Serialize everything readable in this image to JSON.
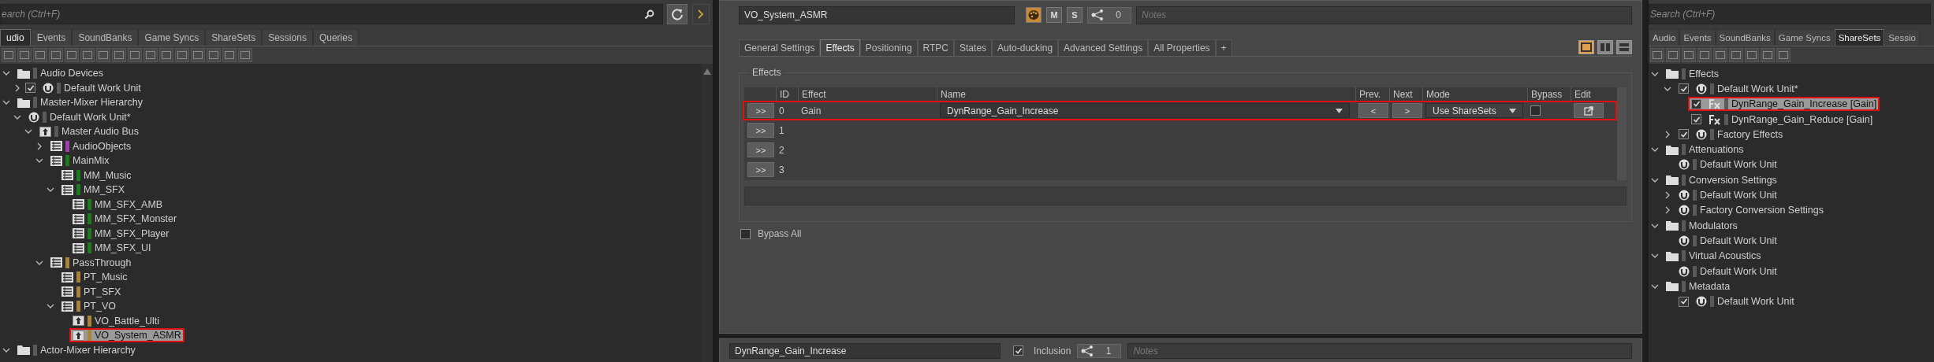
{
  "left_panel": {
    "search": {
      "placeholder": "earch (Ctrl+F)"
    },
    "tabs": [
      {
        "label": "udio",
        "selected": true
      },
      {
        "label": "Events",
        "selected": false
      },
      {
        "label": "SoundBanks",
        "selected": false
      },
      {
        "label": "Game Syncs",
        "selected": false
      },
      {
        "label": "ShareSets",
        "selected": false
      },
      {
        "label": "Sessions",
        "selected": false
      },
      {
        "label": "Queries",
        "selected": false
      }
    ],
    "tree": [
      {
        "label": "Audio Devices",
        "kind": "folder",
        "color": "#5a5a5a",
        "expanded": true,
        "selected": false,
        "highlighted": false,
        "children": [
          {
            "label": "Default Work Unit",
            "kind": "workunit",
            "color": "#5a5a5a",
            "expanded": false,
            "checked": true,
            "selected": false,
            "highlighted": false
          }
        ]
      },
      {
        "label": "Master-Mixer Hierarchy",
        "kind": "folder",
        "color": "#5a5a5a",
        "expanded": true,
        "selected": false,
        "highlighted": false,
        "children": [
          {
            "label": "Default Work Unit*",
            "kind": "workunit",
            "color": "#5a5a5a",
            "expanded": true,
            "selected": false,
            "highlighted": false,
            "children": [
              {
                "label": "Master Audio Bus",
                "kind": "bus",
                "color": "#5a5a5a",
                "expanded": true,
                "selected": false,
                "highlighted": false,
                "children": [
                  {
                    "label": "AudioObjects",
                    "kind": "mixbus",
                    "color": "#a040a8",
                    "expanded": false,
                    "selected": false,
                    "highlighted": false
                  },
                  {
                    "label": "MainMix",
                    "kind": "mixbus",
                    "color": "#1e7a1e",
                    "expanded": true,
                    "selected": false,
                    "highlighted": false,
                    "children": [
                      {
                        "label": "MM_Music",
                        "kind": "mixbus",
                        "color": "#1e7a1e",
                        "selected": false,
                        "highlighted": false
                      },
                      {
                        "label": "MM_SFX",
                        "kind": "mixbus",
                        "color": "#1e7a1e",
                        "expanded": true,
                        "selected": false,
                        "highlighted": false,
                        "children": [
                          {
                            "label": "MM_SFX_AMB",
                            "kind": "mixbus",
                            "color": "#1e7a1e",
                            "selected": false,
                            "highlighted": false
                          },
                          {
                            "label": "MM_SFX_Monster",
                            "kind": "mixbus",
                            "color": "#1e7a1e",
                            "selected": false,
                            "highlighted": false
                          },
                          {
                            "label": "MM_SFX_Player",
                            "kind": "mixbus",
                            "color": "#1e7a1e",
                            "selected": false,
                            "highlighted": false
                          },
                          {
                            "label": "MM_SFX_UI",
                            "kind": "mixbus",
                            "color": "#1e7a1e",
                            "selected": false,
                            "highlighted": false
                          }
                        ]
                      }
                    ]
                  },
                  {
                    "label": "PassThrough",
                    "kind": "mixbus",
                    "color": "#a8843c",
                    "expanded": true,
                    "selected": false,
                    "highlighted": false,
                    "children": [
                      {
                        "label": "PT_Music",
                        "kind": "mixbus",
                        "color": "#a8843c",
                        "selected": false,
                        "highlighted": false
                      },
                      {
                        "label": "PT_SFX",
                        "kind": "mixbus",
                        "color": "#a8843c",
                        "selected": false,
                        "highlighted": false
                      },
                      {
                        "label": "PT_VO",
                        "kind": "mixbus",
                        "color": "#a8843c",
                        "expanded": true,
                        "selected": false,
                        "highlighted": false,
                        "children": [
                          {
                            "label": "VO_Battle_Ulti",
                            "kind": "bus",
                            "color": "#a8843c",
                            "selected": false,
                            "highlighted": false
                          },
                          {
                            "label": "VO_System_ASMR",
                            "kind": "bus",
                            "color": "#a8843c",
                            "selected": true,
                            "highlighted": true
                          }
                        ]
                      }
                    ]
                  }
                ]
              }
            ]
          }
        ]
      },
      {
        "label": "Actor-Mixer Hierarchy",
        "kind": "folder",
        "color": "#5a5a5a",
        "expanded": true,
        "selected": false,
        "highlighted": false
      }
    ]
  },
  "editor": {
    "name": "VO_System_ASMR",
    "mute": "M",
    "solo": "S",
    "share_count": "0",
    "notes": {
      "placeholder": "Notes"
    },
    "tabs": [
      {
        "label": "General Settings",
        "selected": false
      },
      {
        "label": "Effects",
        "selected": true
      },
      {
        "label": "Positioning",
        "selected": false
      },
      {
        "label": "RTPC",
        "selected": false
      },
      {
        "label": "States",
        "selected": false
      },
      {
        "label": "Auto-ducking",
        "selected": false
      },
      {
        "label": "Advanced Settings",
        "selected": false
      },
      {
        "label": "All Properties",
        "selected": false
      }
    ],
    "add_tab": "+",
    "layouts": [
      {
        "selected": true
      },
      {
        "selected": false
      },
      {
        "selected": false
      }
    ],
    "group_title": "Effects",
    "columns": [
      "ID",
      "Effect",
      "Name",
      "Prev.",
      "Next",
      "Mode",
      "Bypass",
      "Edit"
    ],
    "rows": [
      {
        "button": ">>",
        "id": "0",
        "effect": "Gain",
        "name": "DynRange_Gain_Increase",
        "prev": "<",
        "next": ">",
        "mode": "Use ShareSets",
        "bypass": false,
        "highlighted": true
      },
      {
        "button": ">>",
        "id": "1",
        "highlighted": false
      },
      {
        "button": ">>",
        "id": "2",
        "highlighted": false
      },
      {
        "button": ">>",
        "id": "3",
        "highlighted": false
      }
    ],
    "bypass_all": {
      "label": "Bypass All",
      "checked": false
    }
  },
  "lower_editor": {
    "name": "DynRange_Gain_Increase",
    "inclusion": {
      "label": "Inclusion",
      "checked": true
    },
    "share_count": "1",
    "notes": {
      "placeholder": "Notes"
    }
  },
  "right_panel": {
    "search": {
      "placeholder": "Search (Ctrl+F)"
    },
    "tabs": [
      {
        "label": "Audio",
        "selected": false
      },
      {
        "label": "Events",
        "selected": false
      },
      {
        "label": "SoundBanks",
        "selected": false
      },
      {
        "label": "Game Syncs",
        "selected": false
      },
      {
        "label": "ShareSets",
        "selected": true
      },
      {
        "label": "Sessio",
        "selected": false
      }
    ],
    "tree": [
      {
        "label": "Effects",
        "kind": "folder",
        "color": "#5a5a5a",
        "expanded": true,
        "selected": false,
        "highlighted": false,
        "children": [
          {
            "label": "Default Work Unit*",
            "kind": "workunit",
            "color": "#5a5a5a",
            "expanded": true,
            "checked": true,
            "selected": false,
            "highlighted": false,
            "children": [
              {
                "label": "DynRange_Gain_Increase [Gain]",
                "kind": "fx",
                "color": "#5a5a5a",
                "checked": true,
                "selected": true,
                "highlighted": true
              },
              {
                "label": "DynRange_Gain_Reduce [Gain]",
                "kind": "fx",
                "color": "#5a5a5a",
                "checked": true,
                "selected": false,
                "highlighted": false
              }
            ]
          },
          {
            "label": "Factory Effects",
            "kind": "workunit",
            "color": "#5a5a5a",
            "expanded": false,
            "checked": true,
            "selected": false,
            "highlighted": false
          }
        ]
      },
      {
        "label": "Attenuations",
        "kind": "folder",
        "color": "#5a5a5a",
        "expanded": true,
        "selected": false,
        "highlighted": false,
        "children": [
          {
            "label": "Default Work Unit",
            "kind": "workunit",
            "color": "#5a5a5a",
            "selected": false,
            "highlighted": false
          }
        ]
      },
      {
        "label": "Conversion Settings",
        "kind": "folder",
        "color": "#5a5a5a",
        "expanded": true,
        "selected": false,
        "highlighted": false,
        "children": [
          {
            "label": "Default Work Unit",
            "kind": "workunit",
            "color": "#5a5a5a",
            "expanded": false,
            "selected": false,
            "highlighted": false
          },
          {
            "label": "Factory Conversion Settings",
            "kind": "workunit",
            "color": "#5a5a5a",
            "expanded": false,
            "selected": false,
            "highlighted": false
          }
        ]
      },
      {
        "label": "Modulators",
        "kind": "folder",
        "color": "#5a5a5a",
        "expanded": true,
        "selected": false,
        "highlighted": false,
        "children": [
          {
            "label": "Default Work Unit",
            "kind": "workunit",
            "color": "#5a5a5a",
            "selected": false,
            "highlighted": false
          }
        ]
      },
      {
        "label": "Virtual Acoustics",
        "kind": "folder",
        "color": "#5a5a5a",
        "expanded": true,
        "selected": false,
        "highlighted": false,
        "children": [
          {
            "label": "Default Work Unit",
            "kind": "workunit",
            "color": "#5a5a5a",
            "selected": false,
            "highlighted": false
          }
        ]
      },
      {
        "label": "Metadata",
        "kind": "folder",
        "color": "#5a5a5a",
        "expanded": true,
        "selected": false,
        "highlighted": false,
        "children": [
          {
            "label": "Default Work Unit",
            "kind": "workunit",
            "color": "#5a5a5a",
            "checked": true,
            "selected": false,
            "highlighted": false
          }
        ]
      }
    ]
  }
}
